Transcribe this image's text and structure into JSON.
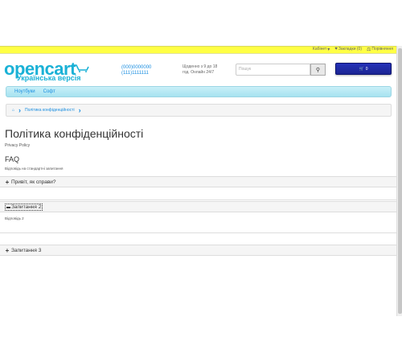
{
  "util": {
    "account": "Кабінет",
    "wishlist": "Закладки (0)",
    "compare": "Порівняння"
  },
  "logo": {
    "brand": "opencart",
    "sub": "Українська версія"
  },
  "phones": {
    "phone1": "(000)0000000",
    "phone2": "(111)1111111"
  },
  "hours": {
    "line1": "Щоденно з 9 до 18",
    "line2": "год. Онлайн 24/7"
  },
  "search": {
    "placeholder": "Пошук"
  },
  "cart": {
    "count": "0"
  },
  "menu": {
    "items": [
      "Ноутбуки",
      "Софт"
    ]
  },
  "breadcrumb": {
    "current": "Політика конфіденційності"
  },
  "page": {
    "title": "Політика конфіденційності",
    "subtitle": "Privacy Policy",
    "faq_heading": "FAQ",
    "default_answer": "Відповідь на стандартні запитання"
  },
  "questions": [
    {
      "sign": "+",
      "label": "Привіт, як справи?"
    },
    {
      "sign": "−",
      "label": "Запитання 2",
      "answer": "Відповідь 2"
    },
    {
      "sign": "+",
      "label": "Запитання 3"
    }
  ],
  "colors": {
    "accent": "#1a8ee0",
    "brand": "#1ab1d6",
    "cart": "#1c2593",
    "topbar": "#ffff44"
  }
}
